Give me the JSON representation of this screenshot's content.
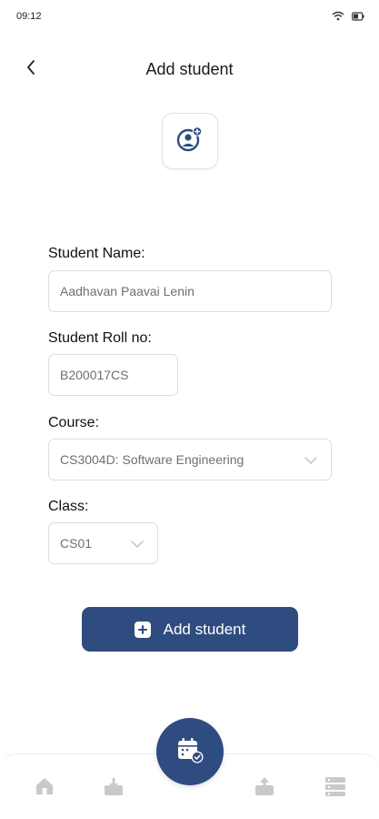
{
  "status_bar": {
    "time": "09:12"
  },
  "header": {
    "title": "Add student"
  },
  "form": {
    "name_label": "Student Name:",
    "name_value": "Aadhavan Paavai Lenin",
    "roll_label": "Student Roll no:",
    "roll_value": "B200017CS",
    "course_label": "Course:",
    "course_value": "CS3004D: Software Engineering",
    "class_label": "Class:",
    "class_value": "CS01"
  },
  "actions": {
    "add_label": "Add student"
  },
  "colors": {
    "accent": "#2f4c80",
    "icon_gray": "#c9c9c9"
  },
  "icons": {
    "back": "chevron-left-icon",
    "avatar": "add-profile-icon",
    "home": "home-icon",
    "download": "download-icon",
    "calendar": "calendar-check-icon",
    "upload": "upload-icon",
    "list": "list-icon"
  }
}
